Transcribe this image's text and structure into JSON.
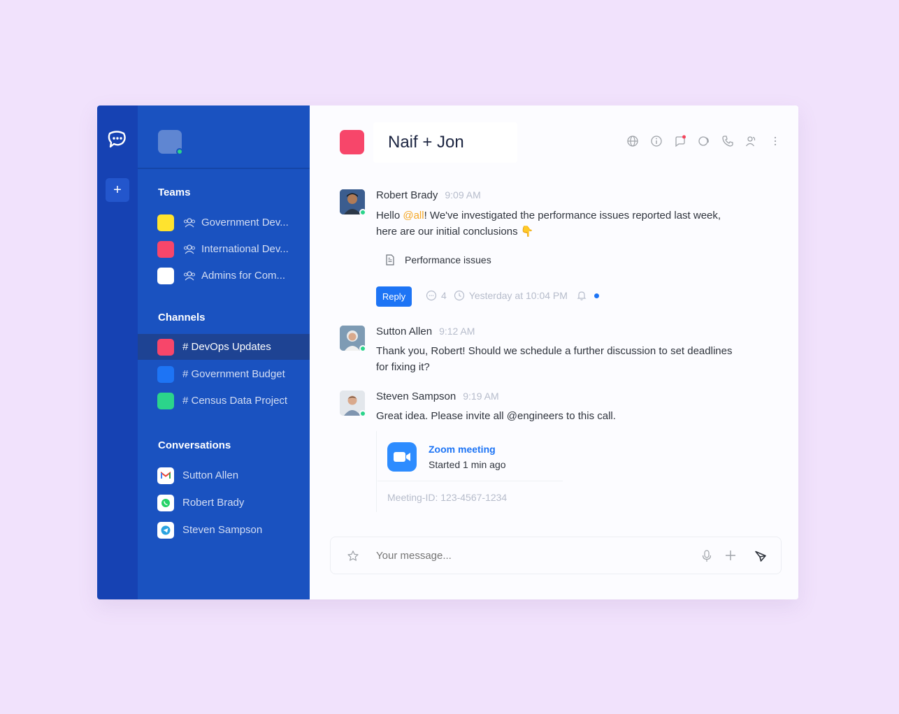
{
  "room": {
    "title": "Naif + Jon"
  },
  "sidebar": {
    "teams_header": "Teams",
    "teams": [
      {
        "label": "Government Dev...",
        "color": "#ffe32e"
      },
      {
        "label": "International Dev...",
        "color": "#f7466a"
      },
      {
        "label": "Admins for Com...",
        "color": "#ffffff"
      }
    ],
    "channels_header": "Channels",
    "channels": [
      {
        "label": "# DevOps Updates",
        "color": "#f7466a",
        "active": true
      },
      {
        "label": "# Government Budget",
        "color": "#1d74f5"
      },
      {
        "label": "# Census Data Project",
        "color": "#2bd48b"
      }
    ],
    "conversations_header": "Conversations",
    "conversations": [
      {
        "label": "Sutton Allen",
        "app": "gmail-icon"
      },
      {
        "label": "Robert Brady",
        "app": "whatsapp-icon"
      },
      {
        "label": "Steven Sampson",
        "app": "telegram-icon"
      }
    ]
  },
  "messages": [
    {
      "name": "Robert Brady",
      "time": "9:09 AM",
      "line1_pre": "Hello ",
      "mention": "@all",
      "line1_post": "! We've investigated the performance issues reported last week,",
      "line2": "here are our initial conclusions 👇",
      "attachment": "Performance issues",
      "reply_label": "Reply",
      "reply_count": "4",
      "last_reply": "Yesterday at 10:04 PM"
    },
    {
      "name": "Sutton Allen",
      "time": "9:12 AM",
      "line1": "Thank you, Robert! Should we schedule a further discussion to set deadlines",
      "line2": "for fixing it?"
    },
    {
      "name": "Steven Sampson",
      "time": "9:19 AM",
      "line1": "Great idea. Please invite all @engineers to this call.",
      "zoom_title": "Zoom meeting",
      "zoom_status": "Started 1 min ago",
      "zoom_id": "Meeting-ID: 123-4567-1234"
    }
  ],
  "composer": {
    "placeholder": "Your message..."
  },
  "colors": {
    "rail": "#1642b3",
    "sidebar": "#1a52c0",
    "accent": "#1d74f5",
    "online": "#2bd48b"
  }
}
